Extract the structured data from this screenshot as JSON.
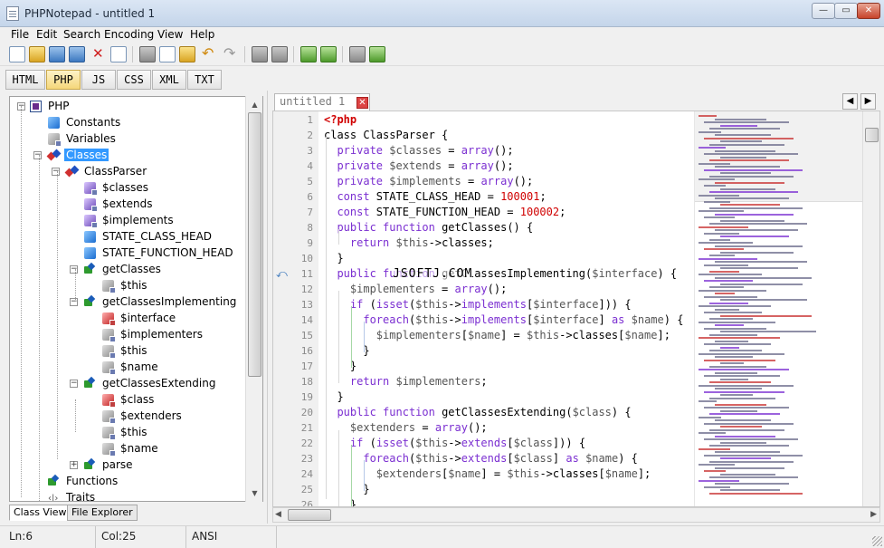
{
  "window": {
    "title": "PHPNotepad - untitled 1"
  },
  "menu": [
    "File",
    "Edit",
    "Search",
    "Encoding",
    "View",
    "Help"
  ],
  "languages": [
    "HTML",
    "PHP",
    "JS",
    "CSS",
    "XML",
    "TXT"
  ],
  "active_language": "PHP",
  "tree": [
    {
      "label": "PHP",
      "icon": "php-file-icon",
      "depth": 0,
      "expander": "-"
    },
    {
      "label": "Constants",
      "icon": "constant-icon",
      "depth": 1,
      "expander": ""
    },
    {
      "label": "Variables",
      "icon": "variable-icon",
      "depth": 1,
      "expander": ""
    },
    {
      "label": "Classes",
      "icon": "classes-icon",
      "depth": 1,
      "expander": "-",
      "selected": true
    },
    {
      "label": "ClassParser",
      "icon": "class-icon",
      "depth": 2,
      "expander": "-"
    },
    {
      "label": "$classes",
      "icon": "private-property-icon",
      "depth": 3,
      "expander": ""
    },
    {
      "label": "$extends",
      "icon": "private-property-icon",
      "depth": 3,
      "expander": ""
    },
    {
      "label": "$implements",
      "icon": "private-property-icon",
      "depth": 3,
      "expander": ""
    },
    {
      "label": "STATE_CLASS_HEAD",
      "icon": "class-constant-icon",
      "depth": 3,
      "expander": ""
    },
    {
      "label": "STATE_FUNCTION_HEAD",
      "icon": "class-constant-icon",
      "depth": 3,
      "expander": ""
    },
    {
      "label": "getClasses",
      "icon": "method-icon",
      "depth": 3,
      "expander": "-"
    },
    {
      "label": "$this",
      "icon": "local-variable-icon",
      "depth": 4,
      "expander": ""
    },
    {
      "label": "getClassesImplementing",
      "icon": "method-icon",
      "depth": 3,
      "expander": "-"
    },
    {
      "label": "$interface",
      "icon": "parameter-icon",
      "depth": 4,
      "expander": ""
    },
    {
      "label": "$implementers",
      "icon": "local-variable-icon",
      "depth": 4,
      "expander": ""
    },
    {
      "label": "$this",
      "icon": "local-variable-icon",
      "depth": 4,
      "expander": ""
    },
    {
      "label": "$name",
      "icon": "local-variable-icon",
      "depth": 4,
      "expander": ""
    },
    {
      "label": "getClassesExtending",
      "icon": "method-icon",
      "depth": 3,
      "expander": "-"
    },
    {
      "label": "$class",
      "icon": "parameter-icon",
      "depth": 4,
      "expander": ""
    },
    {
      "label": "$extenders",
      "icon": "local-variable-icon",
      "depth": 4,
      "expander": ""
    },
    {
      "label": "$this",
      "icon": "local-variable-icon",
      "depth": 4,
      "expander": ""
    },
    {
      "label": "$name",
      "icon": "local-variable-icon",
      "depth": 4,
      "expander": ""
    },
    {
      "label": "parse",
      "icon": "method-icon",
      "depth": 3,
      "expander": "+"
    },
    {
      "label": "Functions",
      "icon": "function-icon",
      "depth": 1,
      "expander": ""
    },
    {
      "label": "Traits",
      "icon": "trait-icon",
      "depth": 1,
      "expander": ""
    }
  ],
  "panel_tabs": [
    "Class View",
    "File Explorer"
  ],
  "editor_tab": {
    "label": "untitled 1"
  },
  "code": [
    [
      [
        "tag",
        "<?php"
      ]
    ],
    [
      [
        "pl",
        "class ClassParser {"
      ]
    ],
    [
      [
        "pl",
        "  "
      ],
      [
        "kw",
        "private"
      ],
      [
        "pl",
        " "
      ],
      [
        "vr",
        "$classes"
      ],
      [
        "pl",
        " = "
      ],
      [
        "kw",
        "array"
      ],
      [
        "pl",
        "();"
      ]
    ],
    [
      [
        "pl",
        "  "
      ],
      [
        "kw",
        "private"
      ],
      [
        "pl",
        " "
      ],
      [
        "vr",
        "$extends"
      ],
      [
        "pl",
        " = "
      ],
      [
        "kw",
        "array"
      ],
      [
        "pl",
        "();"
      ]
    ],
    [
      [
        "pl",
        "  "
      ],
      [
        "kw",
        "private"
      ],
      [
        "pl",
        " "
      ],
      [
        "vr",
        "$implements"
      ],
      [
        "pl",
        " = "
      ],
      [
        "kw",
        "array"
      ],
      [
        "pl",
        "();"
      ]
    ],
    [
      [
        "pl",
        "  "
      ],
      [
        "kw",
        "const"
      ],
      [
        "pl",
        " STATE_CLASS_HEAD = "
      ],
      [
        "num",
        "100001"
      ],
      [
        "pl",
        ";"
      ]
    ],
    [
      [
        "pl",
        "  "
      ],
      [
        "kw",
        "const"
      ],
      [
        "pl",
        " STATE_FUNCTION_HEAD = "
      ],
      [
        "num",
        "100002"
      ],
      [
        "pl",
        ";"
      ]
    ],
    [
      [
        "pl",
        "  "
      ],
      [
        "kw",
        "public"
      ],
      [
        "pl",
        " "
      ],
      [
        "kw",
        "function"
      ],
      [
        "pl",
        " getClasses() {"
      ]
    ],
    [
      [
        "pl",
        "    "
      ],
      [
        "kw",
        "return"
      ],
      [
        "pl",
        " "
      ],
      [
        "vr",
        "$this"
      ],
      [
        "pl",
        "->classes;"
      ]
    ],
    [
      [
        "pl",
        "  }"
      ]
    ],
    [
      [
        "pl",
        "  "
      ],
      [
        "kw",
        "public"
      ],
      [
        "pl",
        " "
      ],
      [
        "kw",
        "function"
      ],
      [
        "pl",
        " getClassesImplementing("
      ],
      [
        "vr",
        "$interface"
      ],
      [
        "pl",
        ") {"
      ]
    ],
    [
      [
        "pl",
        "    "
      ],
      [
        "vr",
        "$implementers"
      ],
      [
        "pl",
        " = "
      ],
      [
        "kw",
        "array"
      ],
      [
        "pl",
        "();"
      ]
    ],
    [
      [
        "pl",
        "    "
      ],
      [
        "kw",
        "if"
      ],
      [
        "pl",
        " ("
      ],
      [
        "kw",
        "isset"
      ],
      [
        "pl",
        "("
      ],
      [
        "vr",
        "$this"
      ],
      [
        "pl",
        "->"
      ],
      [
        "kw",
        "implements"
      ],
      [
        "pl",
        "["
      ],
      [
        "vr",
        "$interface"
      ],
      [
        "pl",
        "])) {"
      ]
    ],
    [
      [
        "pl",
        "      "
      ],
      [
        "kw",
        "foreach"
      ],
      [
        "pl",
        "("
      ],
      [
        "vr",
        "$this"
      ],
      [
        "pl",
        "->"
      ],
      [
        "kw",
        "implements"
      ],
      [
        "pl",
        "["
      ],
      [
        "vr",
        "$interface"
      ],
      [
        "pl",
        "] "
      ],
      [
        "kw",
        "as"
      ],
      [
        "pl",
        " "
      ],
      [
        "vr",
        "$name"
      ],
      [
        "pl",
        ") {"
      ]
    ],
    [
      [
        "pl",
        "        "
      ],
      [
        "vr",
        "$implementers"
      ],
      [
        "pl",
        "["
      ],
      [
        "vr",
        "$name"
      ],
      [
        "pl",
        "] = "
      ],
      [
        "vr",
        "$this"
      ],
      [
        "pl",
        "->classes["
      ],
      [
        "vr",
        "$name"
      ],
      [
        "pl",
        "];"
      ]
    ],
    [
      [
        "pl",
        "      }"
      ]
    ],
    [
      [
        "pl",
        "    }"
      ]
    ],
    [
      [
        "pl",
        "    "
      ],
      [
        "kw",
        "return"
      ],
      [
        "pl",
        " "
      ],
      [
        "vr",
        "$implementers"
      ],
      [
        "pl",
        ";"
      ]
    ],
    [
      [
        "pl",
        "  }"
      ]
    ],
    [
      [
        "pl",
        "  "
      ],
      [
        "kw",
        "public"
      ],
      [
        "pl",
        " "
      ],
      [
        "kw",
        "function"
      ],
      [
        "pl",
        " getClassesExtending("
      ],
      [
        "vr",
        "$class"
      ],
      [
        "pl",
        ") {"
      ]
    ],
    [
      [
        "pl",
        "    "
      ],
      [
        "vr",
        "$extenders"
      ],
      [
        "pl",
        " = "
      ],
      [
        "kw",
        "array"
      ],
      [
        "pl",
        "();"
      ]
    ],
    [
      [
        "pl",
        "    "
      ],
      [
        "kw",
        "if"
      ],
      [
        "pl",
        " ("
      ],
      [
        "kw",
        "isset"
      ],
      [
        "pl",
        "("
      ],
      [
        "vr",
        "$this"
      ],
      [
        "pl",
        "->"
      ],
      [
        "kw",
        "extends"
      ],
      [
        "pl",
        "["
      ],
      [
        "vr",
        "$class"
      ],
      [
        "pl",
        "])) {"
      ]
    ],
    [
      [
        "pl",
        "      "
      ],
      [
        "kw",
        "foreach"
      ],
      [
        "pl",
        "("
      ],
      [
        "vr",
        "$this"
      ],
      [
        "pl",
        "->"
      ],
      [
        "kw",
        "extends"
      ],
      [
        "pl",
        "["
      ],
      [
        "vr",
        "$class"
      ],
      [
        "pl",
        "] "
      ],
      [
        "kw",
        "as"
      ],
      [
        "pl",
        " "
      ],
      [
        "vr",
        "$name"
      ],
      [
        "pl",
        ") {"
      ]
    ],
    [
      [
        "pl",
        "        "
      ],
      [
        "vr",
        "$extenders"
      ],
      [
        "pl",
        "["
      ],
      [
        "vr",
        "$name"
      ],
      [
        "pl",
        "] = "
      ],
      [
        "vr",
        "$this"
      ],
      [
        "pl",
        "->classes["
      ],
      [
        "vr",
        "$name"
      ],
      [
        "pl",
        "];"
      ]
    ],
    [
      [
        "pl",
        "      }"
      ]
    ],
    [
      [
        "pl",
        "    }"
      ]
    ]
  ],
  "line_numbers": [
    "1",
    "2",
    "3",
    "4",
    "5",
    "6",
    "7",
    "8",
    "9",
    "10",
    "11",
    "12",
    "13",
    "14",
    "15",
    "16",
    "17",
    "18",
    "19",
    "20",
    "21",
    "22",
    "23",
    "24",
    "25",
    "26"
  ],
  "watermark": "JSOFTJ.COM",
  "status": {
    "line": "Ln:6",
    "col": "Col:25",
    "encoding": "ANSI"
  },
  "colors": {
    "keyword": "#7b2fd1",
    "number": "#d00000",
    "variable": "#555555",
    "selection": "#3399ff",
    "active_lang": "#f5d77a"
  }
}
